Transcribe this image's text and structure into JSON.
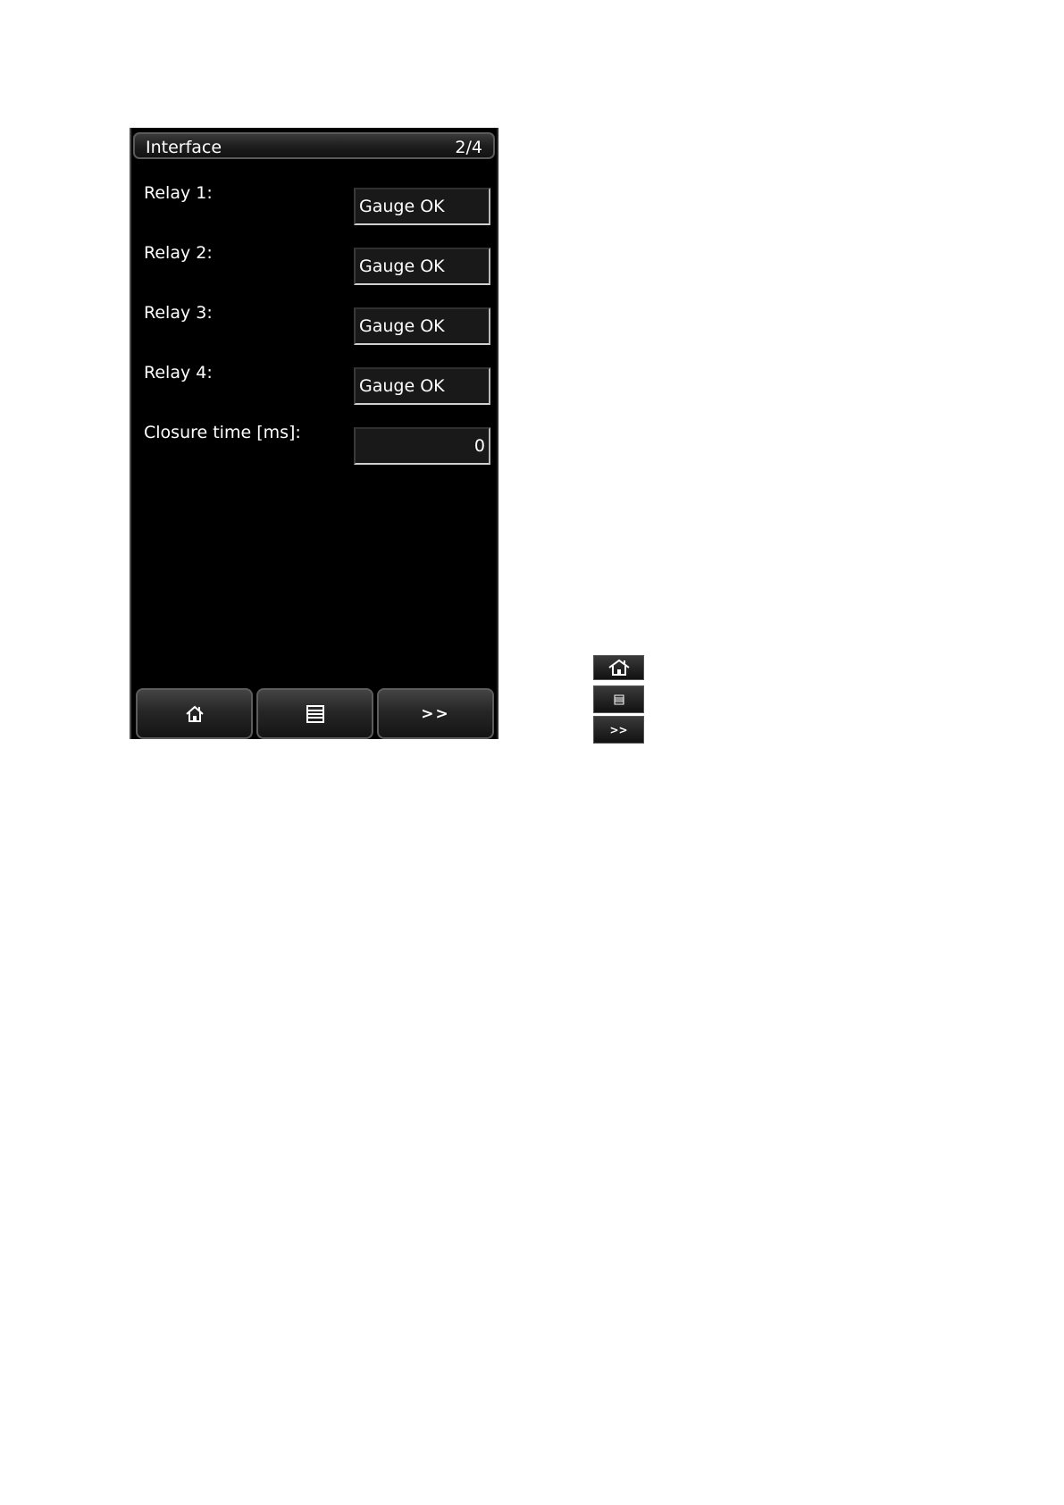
{
  "header": {
    "title": "Interface",
    "page": "2/4"
  },
  "rows": [
    {
      "label": "Relay 1:",
      "value": "Gauge OK"
    },
    {
      "label": "Relay 2:",
      "value": "Gauge OK"
    },
    {
      "label": "Relay 3:",
      "value": "Gauge OK"
    },
    {
      "label": "Relay 4:",
      "value": "Gauge OK"
    },
    {
      "label": "Closure time [ms]:",
      "value": "0"
    }
  ],
  "nav": {
    "home_icon": "home-icon",
    "menu_icon": "menu-list-icon",
    "next_label": ">>"
  },
  "legend": {
    "home_icon": "home-icon",
    "menu_icon": "menu-list-icon",
    "next_label": ">>"
  },
  "colors": {
    "screen_background": "#000000",
    "text": "#ffffff",
    "field_background": "#191919"
  }
}
